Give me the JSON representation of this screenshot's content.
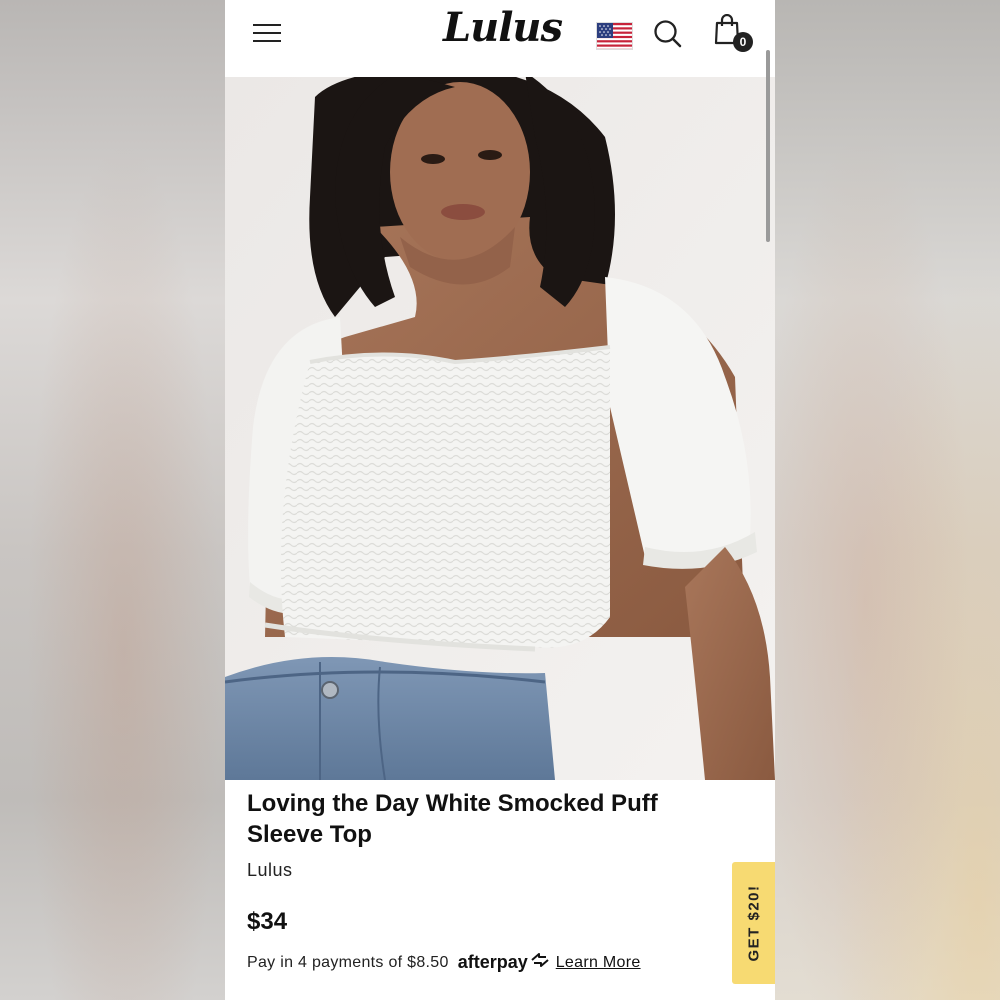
{
  "header": {
    "logo": "Lulus",
    "cart_count": "0",
    "icons": {
      "menu": "hamburger-menu-icon",
      "flag": "us-flag-icon",
      "search": "search-icon",
      "cart": "shopping-bag-icon"
    }
  },
  "gallery": {
    "image_alt": "Model wearing white smocked puff sleeve crop top with denim shorts",
    "total_images": 5,
    "active_index": 0
  },
  "product": {
    "title": "Loving the Day White Smocked Puff Sleeve Top",
    "brand": "Lulus",
    "price": "$34",
    "installments_text": "Pay in 4 payments of $8.50",
    "afterpay_label": "afterpay",
    "learn_more": "Learn More"
  },
  "promo": {
    "label": "GET $20!"
  },
  "colors": {
    "promo_bg": "#f7da72",
    "text": "#111111",
    "badge": "#222222"
  }
}
